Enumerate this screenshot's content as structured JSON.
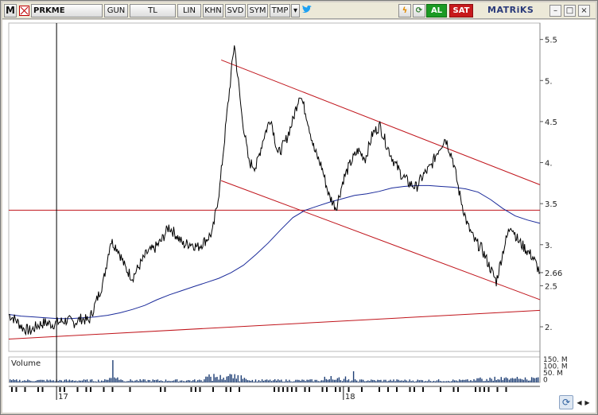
{
  "toolbar": {
    "logo": "M",
    "symbol": "PRKME",
    "period": "GUN",
    "currency": "TL",
    "scale_lin": "LIN",
    "btn_khn": "KHN",
    "btn_svd": "SVD",
    "btn_sym": "SYM",
    "btn_tmp": "TMP",
    "dropdown_glyph": "▾",
    "twitter_icon": "twitter-bird-icon",
    "flash_glyph": "ϟ",
    "refresh_glyph": "⟳",
    "buy_label": "AL",
    "sell_label": "SAT",
    "brand": "MATRiKS",
    "win_min": "–",
    "win_max": "□",
    "win_close": "×"
  },
  "colors": {
    "price_line": "#000000",
    "moving_average": "#1a2a9a",
    "trend_lines": "#c0141b",
    "volume_bars": "#1f3f75",
    "buy": "#1b9a23",
    "sell": "#c7191c"
  },
  "chart_data": {
    "type": "line",
    "symbol": "PRKME",
    "y_axis_ticks": [
      "5.5",
      "5.",
      "4.5",
      "4.",
      "3.5",
      "3.",
      "2.66",
      "2.5",
      "2."
    ],
    "last_price": "2.66",
    "ylim": [
      1.7,
      5.7
    ],
    "x_axis_labels": [
      "17",
      "18"
    ],
    "volume": {
      "label": "Volume",
      "ticks": [
        "150. M",
        "100. M",
        "50. M",
        "0"
      ]
    },
    "series": [
      {
        "values_note": "price",
        "values": [
          2.15,
          2.08,
          1.98,
          1.95,
          2.02,
          2.05,
          2.03,
          2.06,
          2.08,
          2.05,
          2.1,
          2.07,
          2.3,
          2.55,
          3.05,
          2.95,
          2.72,
          2.6,
          2.75,
          2.9,
          2.95,
          3.05,
          3.22,
          3.12,
          3.0,
          3.02,
          2.97,
          3.05,
          3.15,
          3.7,
          4.6,
          5.45,
          4.6,
          4.0,
          3.95,
          4.3,
          4.55,
          4.1,
          4.25,
          4.5,
          4.85,
          4.55,
          4.15,
          3.95,
          3.6,
          3.45,
          3.8,
          4.0,
          4.15,
          4.05,
          4.35,
          4.45,
          4.2,
          4.0,
          3.85,
          3.75,
          3.7,
          3.85,
          3.95,
          4.15,
          4.3,
          4.05,
          3.6,
          3.25,
          3.05,
          2.95,
          2.75,
          2.55,
          2.95,
          3.25,
          3.05,
          2.95,
          2.85,
          2.66
        ]
      },
      {
        "values_note": "moving-average",
        "values": [
          2.15,
          2.13,
          2.12,
          2.11,
          2.1,
          2.1,
          2.11,
          2.12,
          2.14,
          2.17,
          2.21,
          2.26,
          2.33,
          2.39,
          2.44,
          2.49,
          2.54,
          2.59,
          2.66,
          2.75,
          2.88,
          3.02,
          3.18,
          3.33,
          3.42,
          3.47,
          3.52,
          3.56,
          3.6,
          3.62,
          3.65,
          3.69,
          3.71,
          3.72,
          3.72,
          3.71,
          3.7,
          3.68,
          3.64,
          3.55,
          3.44,
          3.35,
          3.3,
          3.26
        ]
      }
    ],
    "trend_lines": [
      {
        "from": [
          0,
          1.85
        ],
        "to": [
          1,
          2.2
        ]
      },
      {
        "from": [
          0,
          3.42
        ],
        "to": [
          1,
          3.42
        ]
      },
      {
        "from": [
          0.4,
          5.25
        ],
        "to": [
          1,
          3.73
        ]
      },
      {
        "from": [
          0.4,
          3.78
        ],
        "to": [
          1,
          2.33
        ]
      }
    ],
    "cursor_x": 0.09
  }
}
